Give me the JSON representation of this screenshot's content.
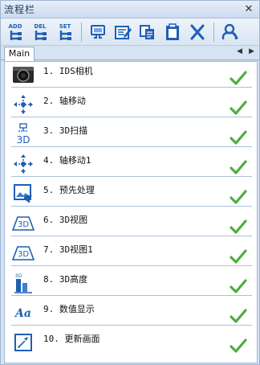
{
  "window": {
    "title": "流程栏"
  },
  "toolbar": {
    "buttons": [
      {
        "icon": "add-step-icon",
        "text": "ADD"
      },
      {
        "icon": "delete-step-icon",
        "text": "DEL"
      },
      {
        "icon": "set-step-icon",
        "text": "SET"
      },
      {
        "icon": "run-icon"
      },
      {
        "icon": "edit-icon"
      },
      {
        "icon": "copy-icon"
      },
      {
        "icon": "paste-icon"
      },
      {
        "icon": "cut-icon"
      },
      {
        "icon": "user-search-icon"
      }
    ]
  },
  "tabs": [
    {
      "label": "Main",
      "active": true
    }
  ],
  "steps": [
    {
      "label": "1. IDS相机",
      "icon": "camera-icon",
      "status": "ok"
    },
    {
      "label": "2. 轴移动",
      "icon": "axis-move-icon",
      "status": "ok"
    },
    {
      "label": "3. 3D扫描",
      "icon": "3d-scan-icon",
      "status": "ok"
    },
    {
      "label": "4. 轴移动1",
      "icon": "axis-move-icon",
      "status": "ok"
    },
    {
      "label": "5. 预先处理",
      "icon": "preprocess-icon",
      "status": "ok"
    },
    {
      "label": "6. 3D视图",
      "icon": "3d-view-icon",
      "status": "ok"
    },
    {
      "label": "7. 3D视图1",
      "icon": "3d-view-icon",
      "status": "ok"
    },
    {
      "label": "8. 3D高度",
      "icon": "3d-height-icon",
      "status": "ok"
    },
    {
      "label": "9. 数值显示",
      "icon": "value-display-icon",
      "status": "ok"
    },
    {
      "label": "10. 更新画面",
      "icon": "refresh-screen-icon",
      "status": "ok"
    }
  ],
  "colors": {
    "check": "#4caf3c",
    "accent": "#1e5fb4",
    "panel": "#d6e3f2"
  }
}
